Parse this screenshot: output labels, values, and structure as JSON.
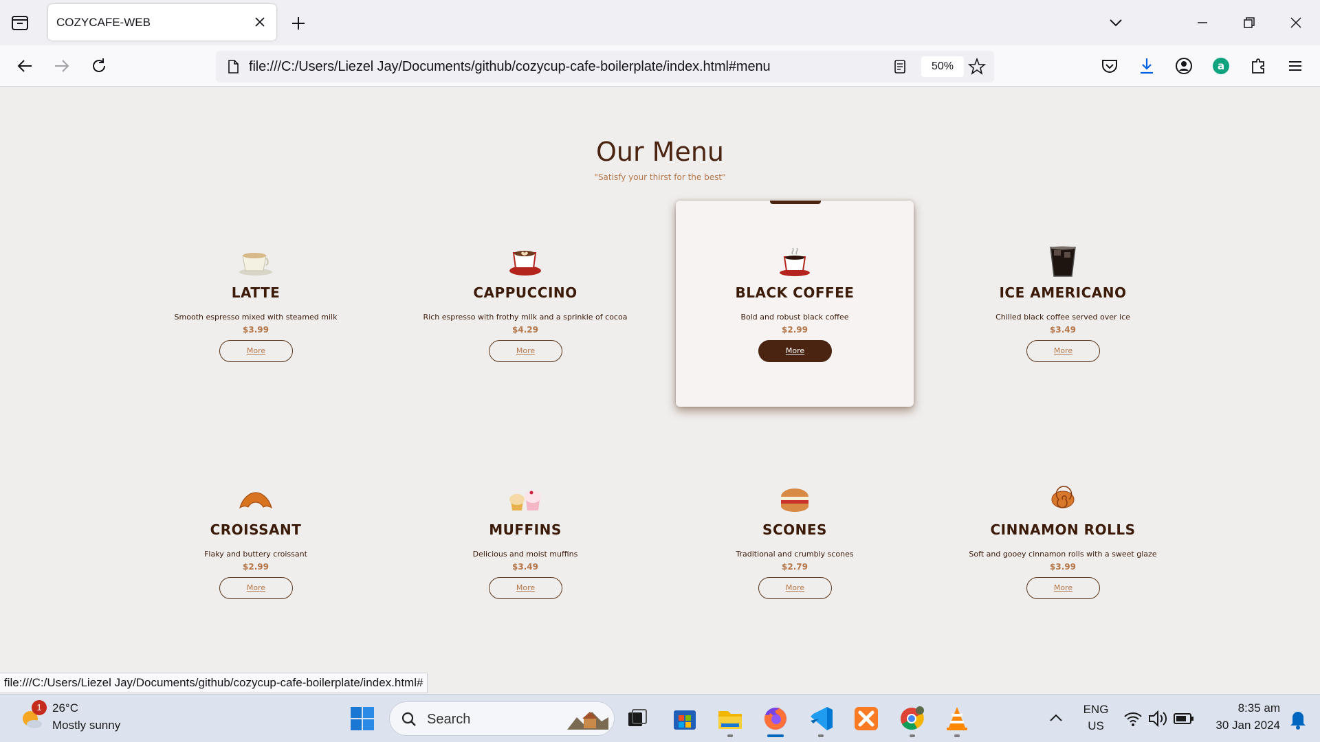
{
  "browser": {
    "tab_title": "COZYCAFE-WEB",
    "url": "file:///C:/Users/Liezel Jay/Documents/github/cozycup-cafe-boilerplate/index.html#menu",
    "zoom": "50%",
    "status_url": "file:///C:/Users/Liezel Jay/Documents/github/cozycup-cafe-boilerplate/index.html#"
  },
  "menu": {
    "title": "Our Menu",
    "subtitle": "\"Satisfy your thirst for the best\"",
    "items": [
      {
        "name": "LATTE",
        "desc": "Smooth espresso mixed with steamed milk",
        "price": "$3.99",
        "button": "More",
        "icon": "latte-icon"
      },
      {
        "name": "CAPPUCCINO",
        "desc": "Rich espresso with frothy milk and a sprinkle of cocoa",
        "price": "$4.29",
        "button": "More",
        "icon": "cappuccino-icon"
      },
      {
        "name": "BLACK COFFEE",
        "desc": "Bold and robust black coffee",
        "price": "$2.99",
        "button": "More",
        "icon": "black-coffee-icon",
        "active": true
      },
      {
        "name": "ICE AMERICANO",
        "desc": "Chilled black coffee served over ice",
        "price": "$3.49",
        "button": "More",
        "icon": "iced-coffee-icon"
      },
      {
        "name": "CROISSANT",
        "desc": "Flaky and buttery croissant",
        "price": "$2.99",
        "button": "More",
        "icon": "croissant-icon"
      },
      {
        "name": "MUFFINS",
        "desc": "Delicious and moist muffins",
        "price": "$3.49",
        "button": "More",
        "icon": "muffin-icon"
      },
      {
        "name": "SCONES",
        "desc": "Traditional and crumbly scones",
        "price": "$2.79",
        "button": "More",
        "icon": "scone-icon"
      },
      {
        "name": "CINNAMON ROLLS",
        "desc": "Soft and gooey cinnamon rolls with a sweet glaze",
        "price": "$3.99",
        "button": "More",
        "icon": "cinnamon-roll-icon"
      }
    ]
  },
  "taskbar": {
    "weather_temp": "26°C",
    "weather_desc": "Mostly sunny",
    "weather_badge": "1",
    "search_label": "Search",
    "lang_top": "ENG",
    "lang_bottom": "US",
    "time": "8:35 am",
    "date": "30 Jan 2024"
  },
  "colors": {
    "brand_dark": "#4a2410",
    "accent": "#b5774a",
    "page_bg": "#f0eeed"
  }
}
